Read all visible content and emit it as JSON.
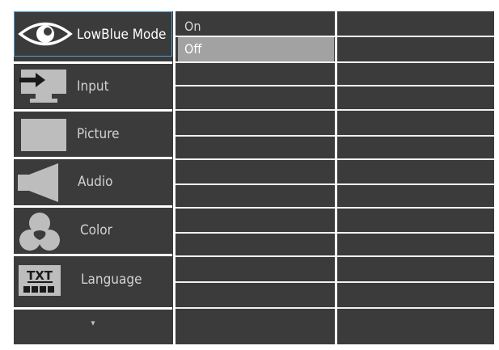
{
  "menu": {
    "items": [
      {
        "label": "LowBlue Mode",
        "icon": "eye-icon",
        "selected": true
      },
      {
        "label": "Input",
        "icon": "input-icon",
        "selected": false
      },
      {
        "label": "Picture",
        "icon": "picture-icon",
        "selected": false
      },
      {
        "label": "Audio",
        "icon": "speaker-icon",
        "selected": false
      },
      {
        "label": "Color",
        "icon": "color-icon",
        "selected": false
      },
      {
        "label": "Language",
        "icon": "language-txt-icon",
        "selected": false
      }
    ],
    "more_indicator": "▾"
  },
  "submenu": {
    "options": [
      {
        "label": "On",
        "selected": false
      },
      {
        "label": "Off",
        "selected": true
      }
    ]
  },
  "icons": {
    "language_icon_text": "TXT"
  },
  "colors": {
    "background": "#3b3b3b",
    "selection_highlight": "#a2a2a2",
    "active_border": "#4a9fd8",
    "text": "#d2d2d2"
  }
}
